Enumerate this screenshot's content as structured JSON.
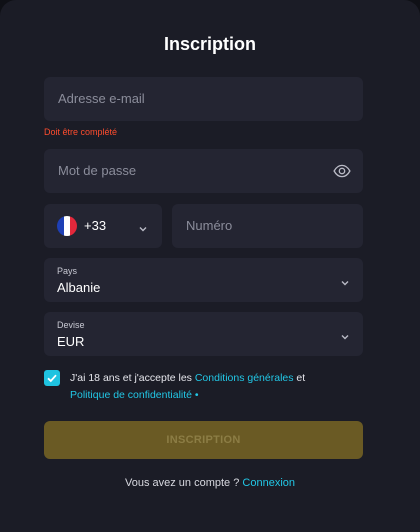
{
  "form": {
    "title": "Inscription",
    "email": {
      "placeholder": "Adresse e-mail",
      "error": "Doit être complété"
    },
    "password": {
      "placeholder": "Mot de passe"
    },
    "phone": {
      "country_code": "+33",
      "placeholder": "Numéro"
    },
    "country": {
      "label": "Pays",
      "value": "Albanie"
    },
    "currency": {
      "label": "Devise",
      "value": "EUR"
    },
    "terms": {
      "checked": true,
      "text_before": "J'ai 18 ans et j'accepte les ",
      "link_conditions": "Conditions générales",
      "text_middle": " et",
      "link_privacy": "Politique de confidentialité",
      "required_mark": " •"
    },
    "submit_label": "INSCRIPTION",
    "login_prompt": "Vous avez un compte ? ",
    "login_link": "Connexion"
  },
  "colors": {
    "background": "#1b1c26",
    "field": "#242532",
    "accent": "#22c7e6",
    "error": "#ff4d2e",
    "submit_disabled": "#6a5a24"
  }
}
